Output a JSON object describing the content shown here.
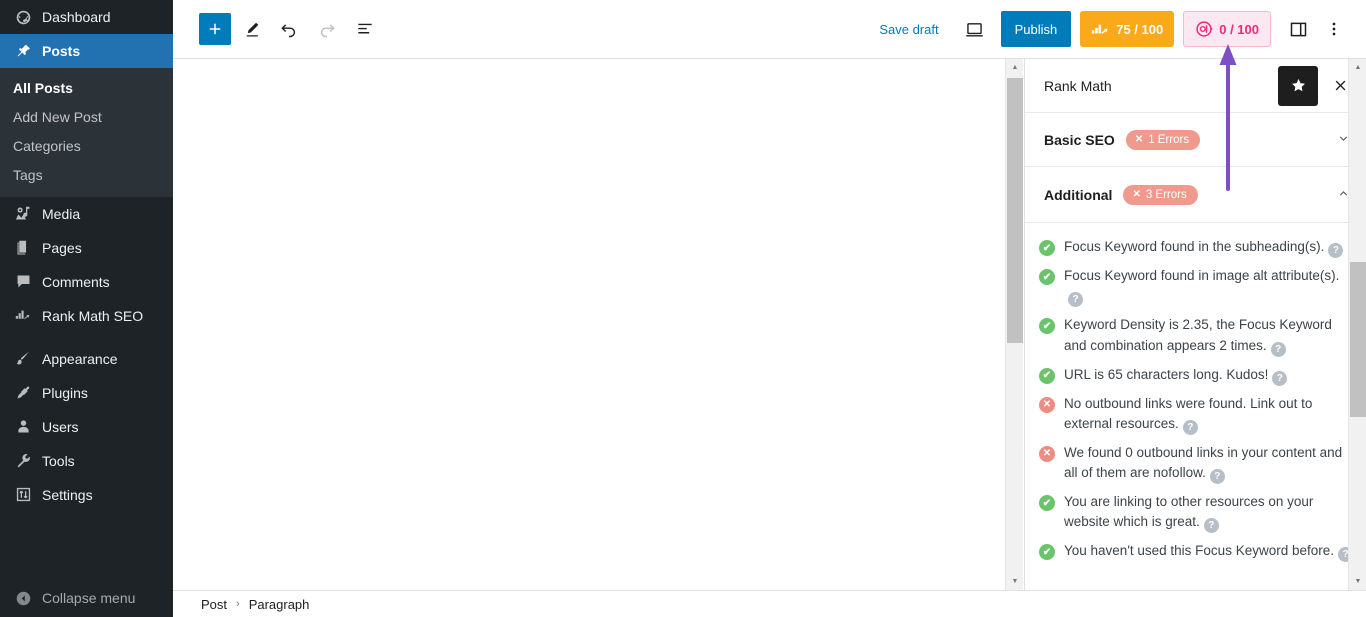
{
  "sidebar": {
    "items": [
      {
        "label": "Dashboard",
        "icon": "dashboard-icon",
        "active": false
      },
      {
        "label": "Posts",
        "icon": "pin-icon",
        "active": true
      },
      {
        "label": "Media",
        "icon": "media-icon",
        "active": false
      },
      {
        "label": "Pages",
        "icon": "pages-icon",
        "active": false
      },
      {
        "label": "Comments",
        "icon": "comments-icon",
        "active": false
      },
      {
        "label": "Rank Math SEO",
        "icon": "rankmath-icon",
        "active": false
      },
      {
        "label": "Appearance",
        "icon": "brush-icon",
        "active": false
      },
      {
        "label": "Plugins",
        "icon": "plug-icon",
        "active": false
      },
      {
        "label": "Users",
        "icon": "user-icon",
        "active": false
      },
      {
        "label": "Tools",
        "icon": "wrench-icon",
        "active": false
      },
      {
        "label": "Settings",
        "icon": "sliders-icon",
        "active": false
      }
    ],
    "submenu": [
      {
        "label": "All Posts",
        "current": true
      },
      {
        "label": "Add New Post",
        "current": false
      },
      {
        "label": "Categories",
        "current": false
      },
      {
        "label": "Tags",
        "current": false
      }
    ],
    "collapse_label": "Collapse menu"
  },
  "toolbar": {
    "add_block_icon": "plus-icon",
    "tools": [
      {
        "name": "edit-tool-icon",
        "disabled": false
      },
      {
        "name": "undo-icon",
        "disabled": false
      },
      {
        "name": "redo-icon",
        "disabled": true
      },
      {
        "name": "document-overview-icon",
        "disabled": false
      }
    ],
    "save_draft_label": "Save draft",
    "preview_icon": "preview-laptop-icon",
    "publish_label": "Publish",
    "seo_score": {
      "value": "75 / 100",
      "icon": "rankmath-logo-icon",
      "bg": "#f9a91a",
      "fg": "#ffffff"
    },
    "content_ai_score": {
      "value": "0 / 100",
      "icon": "content-ai-icon",
      "bg": "#fde7f1",
      "fg": "#ee2a7b"
    },
    "settings_sidebar_icon": "panel-toggle-icon",
    "more_options_icon": "kebab-menu-icon"
  },
  "breadcrumb": {
    "items": [
      "Post",
      "Paragraph"
    ],
    "separator": "›"
  },
  "rank_math_panel": {
    "title": "Rank Math",
    "star_icon": "star-icon",
    "close_icon": "close-icon",
    "sections": [
      {
        "title": "Basic SEO",
        "badge": "1 Errors",
        "badge_color": "#ef9a8d",
        "expanded": false,
        "chevron": "chevron-down-icon"
      },
      {
        "title": "Additional",
        "badge": "3 Errors",
        "badge_color": "#ef9a8d",
        "expanded": true,
        "chevron": "chevron-up-icon"
      }
    ],
    "additional_checks": [
      {
        "status": "ok",
        "text": "Focus Keyword found in the subheading(s).",
        "help": true
      },
      {
        "status": "ok",
        "text": "Focus Keyword found in image alt attribute(s).",
        "help": true
      },
      {
        "status": "ok",
        "text": "Keyword Density is 2.35, the Focus Keyword and combination appears 2 times.",
        "help": true
      },
      {
        "status": "ok",
        "text": "URL is 65 characters long. Kudos!",
        "help": true
      },
      {
        "status": "bad",
        "text": "No outbound links were found. Link out to external resources.",
        "help": true
      },
      {
        "status": "bad",
        "text": "We found 0 outbound links in your content and all of them are nofollow.",
        "help": true
      },
      {
        "status": "ok",
        "text": "You are linking to other resources on your website which is great.",
        "help": true
      },
      {
        "status": "ok",
        "text": "You haven't used this Focus Keyword before.",
        "help": true
      }
    ],
    "status_icons": {
      "ok": "✔",
      "bad": "✕"
    },
    "help_icon_glyph": "?"
  },
  "annotation": {
    "arrow_color": "#7d4fc4",
    "points_to": "content-ai-score-button"
  }
}
